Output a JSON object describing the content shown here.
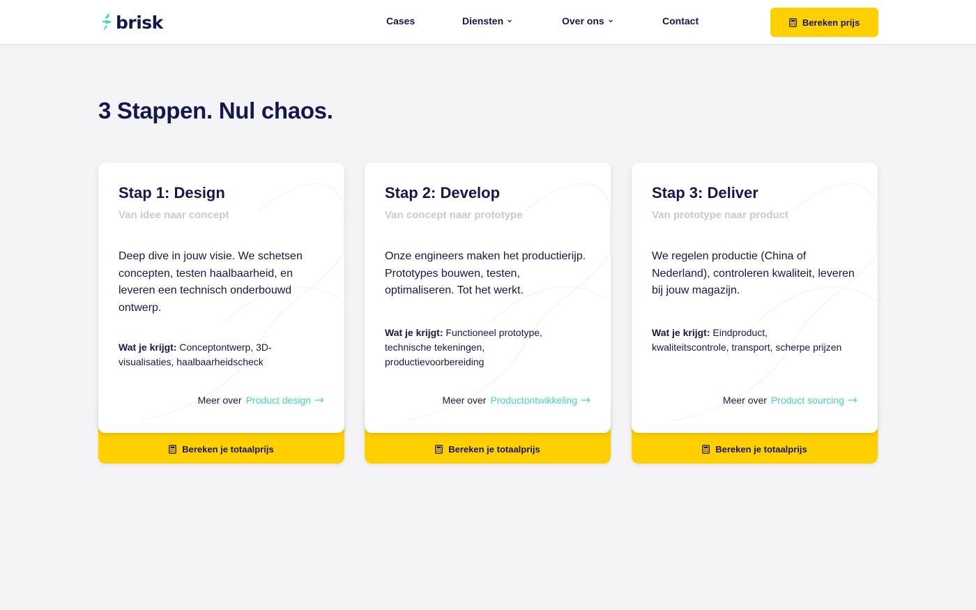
{
  "brand": {
    "name": "brisk",
    "logo_icon": "brisk-logo-icon",
    "accent": "#3ddcb4"
  },
  "nav": {
    "items": [
      {
        "label": "Cases",
        "has_dropdown": false
      },
      {
        "label": "Diensten",
        "has_dropdown": true
      },
      {
        "label": "Over ons",
        "has_dropdown": true
      },
      {
        "label": "Contact",
        "has_dropdown": false
      }
    ],
    "cta_label": "Bereken prijs",
    "cta_icon": "calculator-icon",
    "cta_color": "#ffcf00"
  },
  "section": {
    "title": "3 Stappen. Nul chaos."
  },
  "cards": [
    {
      "title": "Stap 1: Design",
      "subtitle": "Van idee naar concept",
      "description": "Deep dive in jouw visie. We schetsen concepten, testen haalbaarheid, en leveren een technisch onderbouwd ontwerp.",
      "get_label": "Wat je krijgt:",
      "get_text": " Conceptontwerp, 3D-visualisaties, haalbaarheidscheck",
      "more_prefix": "Meer over",
      "more_link": "Product design",
      "footer_label": "Bereken je totaalprijs"
    },
    {
      "title": "Stap 2: Develop",
      "subtitle": "Van concept naar prototype",
      "description": "Onze engineers maken het productierijp. Prototypes bouwen, testen, optimaliseren. Tot het werkt.",
      "get_label": "Wat je krijgt:",
      "get_text": " Functioneel prototype, technische tekeningen, productievoorbereiding",
      "more_prefix": "Meer over",
      "more_link": "Productontwikkeling",
      "footer_label": "Bereken je totaalprijs"
    },
    {
      "title": "Stap 3: Deliver",
      "subtitle": "Van prototype naar product",
      "description": "We regelen productie (China of Nederland), controleren kwaliteit, leveren bij jouw magazijn.",
      "get_label": "Wat je krijgt:",
      "get_text": " Eindproduct, kwaliteitscontrole, transport, scherpe prijzen",
      "more_prefix": "Meer over",
      "more_link": "Product sourcing",
      "footer_label": "Bereken je totaalprijs"
    }
  ]
}
